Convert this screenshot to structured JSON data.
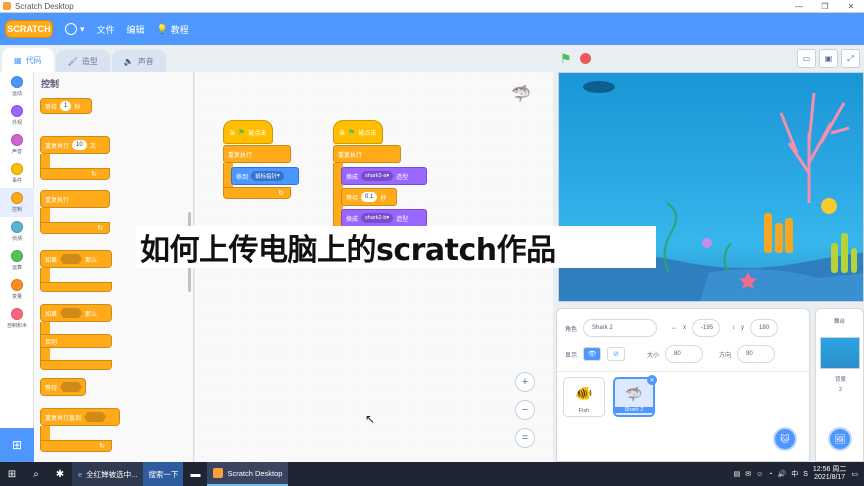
{
  "window": {
    "title": "Scratch Desktop"
  },
  "menubar": {
    "logo": "SCRATCH",
    "file": "文件",
    "edit": "编辑",
    "tutorials": "教程"
  },
  "tabs": {
    "code": "代码",
    "costumes": "造型",
    "sounds": "声音"
  },
  "categories": [
    {
      "label": "运动",
      "color": "#4c97ff"
    },
    {
      "label": "外观",
      "color": "#9966ff"
    },
    {
      "label": "声音",
      "color": "#cf63cf"
    },
    {
      "label": "事件",
      "color": "#ffbf00"
    },
    {
      "label": "控制",
      "color": "#ffab19"
    },
    {
      "label": "侦测",
      "color": "#5cb1d6"
    },
    {
      "label": "运算",
      "color": "#59c059"
    },
    {
      "label": "变量",
      "color": "#ff8c1a"
    },
    {
      "label": "自制积木",
      "color": "#ff6680"
    }
  ],
  "palette": {
    "title": "控制",
    "wait": "等待",
    "wait_value": "1",
    "seconds": "秒",
    "repeat": "重复执行",
    "repeat_value": "10",
    "times": "次",
    "forever": "重复执行",
    "if": "如果",
    "then": "那么",
    "if2": "如果",
    "then2": "那么",
    "else": "否则",
    "wait_until": "等待",
    "repeat_until": "重复执行直到"
  },
  "code": {
    "script1": {
      "hat": "当",
      "hat_suffix": "被点击",
      "forever": "重复执行",
      "goto": "移到",
      "goto_target": "鼠标指针"
    },
    "script2": {
      "hat": "当",
      "hat_suffix": "被点击",
      "forever": "重复执行",
      "switch1": "换成",
      "costume1": "shark2-a",
      "costume_word1": "造型",
      "wait": "等待",
      "wait_value": "0.1",
      "seconds": "秒",
      "switch2": "换成",
      "costume2": "shark2-b",
      "costume_word2": "造型"
    }
  },
  "caption": "如何上传电脑上的scratch作品",
  "sprite_info": {
    "sprite_label": "角色",
    "sprite_name": "Shark 2",
    "x_label": "x",
    "x_value": "-195",
    "y_label": "y",
    "y_value": "180",
    "show_label": "显示",
    "size_label": "大小",
    "size_value": "80",
    "direction_label": "方向",
    "direction_value": "90"
  },
  "sprites": [
    {
      "name": "Fish"
    },
    {
      "name": "Shark 2"
    }
  ],
  "stage_pane": {
    "title": "舞台",
    "backdrops_label": "背景",
    "backdrops_count": "2"
  },
  "taskbar": {
    "ie_title": "全红婵被选中...",
    "search_button": "搜索一下",
    "scratch_app": "Scratch Desktop",
    "ime": "中",
    "time": "12:56 周二",
    "date": "2021/8/17"
  }
}
